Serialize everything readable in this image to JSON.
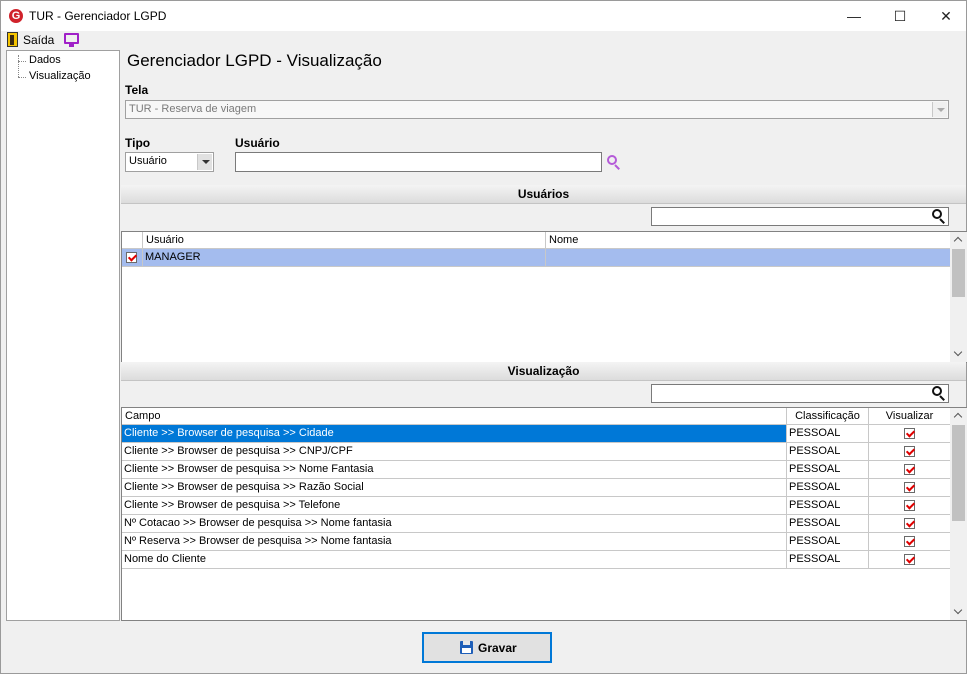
{
  "window": {
    "title": "TUR - Gerenciador LGPD",
    "app_icon_letter": "G"
  },
  "menu": {
    "exit_label": "Saída"
  },
  "tree": {
    "items": [
      "Dados",
      "Visualização"
    ]
  },
  "page": {
    "title": "Gerenciador LGPD - Visualização"
  },
  "form": {
    "tela_label": "Tela",
    "tela_value": "TUR - Reserva de viagem",
    "tipo_label": "Tipo",
    "tipo_value": "Usuário",
    "usuario_label": "Usuário",
    "usuario_value": ""
  },
  "users_section": {
    "header": "Usuários",
    "search_value": "",
    "columns": [
      "Usuário",
      "Nome"
    ],
    "rows": [
      {
        "checked": true,
        "usuario": "MANAGER",
        "nome": ""
      }
    ]
  },
  "view_section": {
    "header": "Visualização",
    "search_value": "",
    "columns": [
      "Campo",
      "Classificação",
      "Visualizar"
    ],
    "rows": [
      {
        "campo": "Cliente >> Browser de pesquisa >> Cidade",
        "classificacao": "PESSOAL",
        "visualizar": true
      },
      {
        "campo": "Cliente >> Browser de pesquisa >> CNPJ/CPF",
        "classificacao": "PESSOAL",
        "visualizar": true
      },
      {
        "campo": "Cliente >> Browser de pesquisa >> Nome Fantasia",
        "classificacao": "PESSOAL",
        "visualizar": true
      },
      {
        "campo": "Cliente >> Browser de pesquisa >> Razão Social",
        "classificacao": "PESSOAL",
        "visualizar": true
      },
      {
        "campo": "Cliente >> Browser de pesquisa >> Telefone",
        "classificacao": "PESSOAL",
        "visualizar": true
      },
      {
        "campo": "Nº Cotacao >> Browser de pesquisa >> Nome fantasia",
        "classificacao": "PESSOAL",
        "visualizar": true
      },
      {
        "campo": "Nº Reserva >> Browser de pesquisa >> Nome fantasia",
        "classificacao": "PESSOAL",
        "visualizar": true
      },
      {
        "campo": "Nome do Cliente",
        "classificacao": "PESSOAL",
        "visualizar": true
      }
    ]
  },
  "footer": {
    "save_label": "Gravar"
  },
  "colors": {
    "selected_row_user": "#a4bcee",
    "selected_row_view": "#0078d7",
    "check_red": "#e00000",
    "accent_purple": "#a020c8"
  }
}
